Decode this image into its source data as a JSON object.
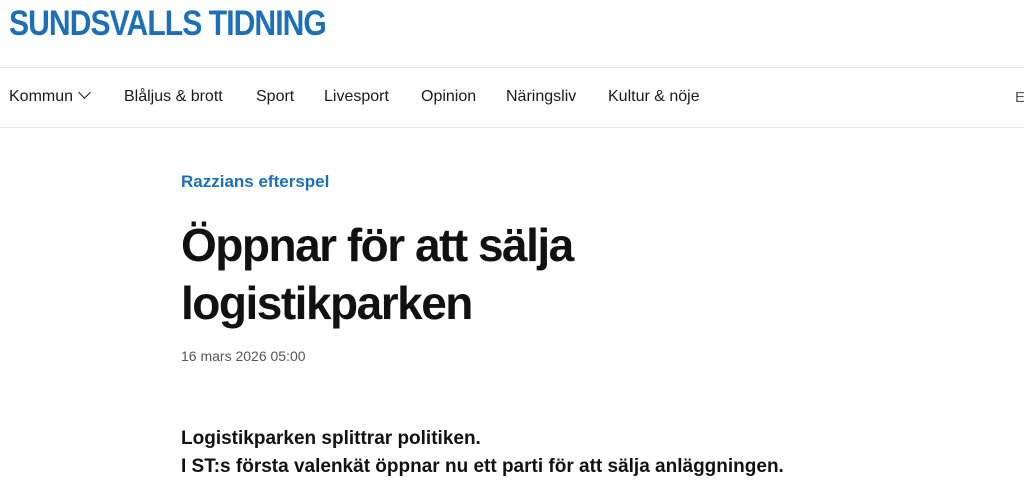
{
  "header": {
    "logo_text": "SUNDSVALLS TIDNING",
    "brand_color": "#1d6fb8"
  },
  "nav": {
    "items": [
      {
        "label": "Kommun",
        "has_dropdown": true
      },
      {
        "label": "Blåljus & brott"
      },
      {
        "label": "Sport"
      },
      {
        "label": "Livesport"
      },
      {
        "label": "Opinion"
      },
      {
        "label": "Näringsliv"
      },
      {
        "label": "Kultur & nöje"
      }
    ],
    "overflow_text": "E"
  },
  "article": {
    "kicker": "Razzians efterspel",
    "headline": "Öppnar för att sälja logistikparken",
    "published": "16 mars 2026 05:00",
    "lead_lines": [
      "Logistikparken splittrar politiken.",
      "I ST:s första valenkät öppnar nu ett parti för att sälja anläggningen."
    ]
  }
}
